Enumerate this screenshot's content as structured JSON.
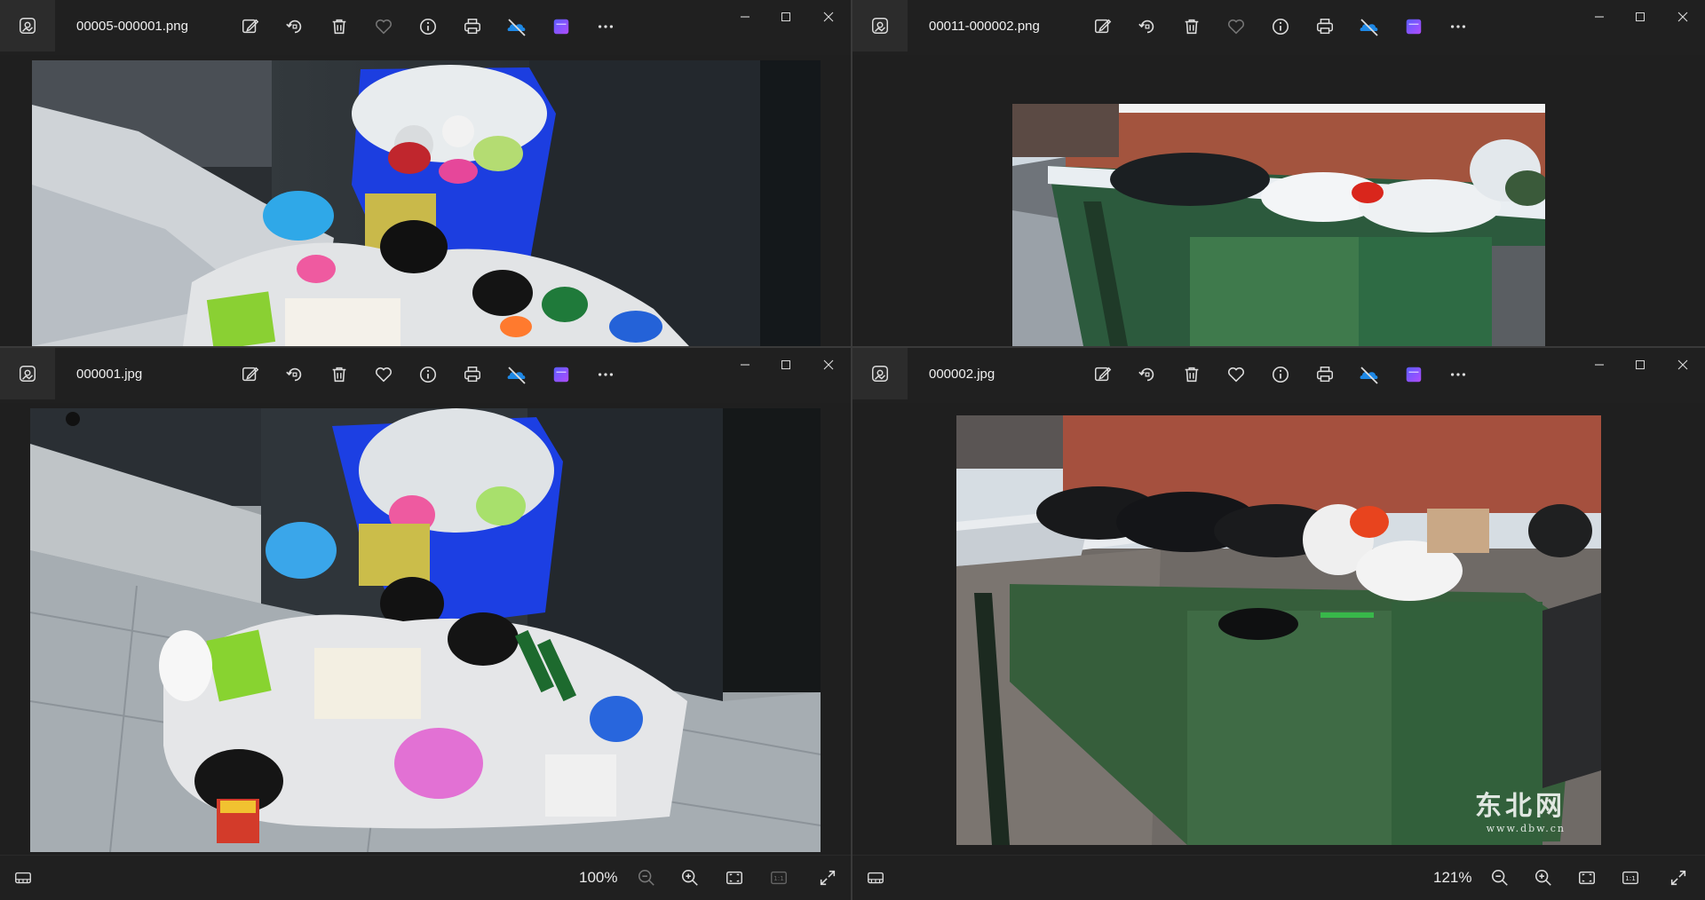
{
  "windows": {
    "tl": {
      "filename": "00005-000001.png"
    },
    "tr": {
      "filename": "00011-000002.png"
    },
    "bl": {
      "filename": "000001.jpg",
      "zoom": "100%"
    },
    "br": {
      "filename": "000002.jpg",
      "zoom": "121%"
    }
  },
  "toolbar_icons": [
    "edit-image-icon",
    "rotate-icon",
    "delete-icon",
    "favorite-icon",
    "info-icon",
    "print-icon",
    "onedrive-icon",
    "clipchamp-icon",
    "more-icon"
  ],
  "window_controls": [
    "minimize-icon",
    "maximize-icon",
    "close-icon"
  ],
  "watermark": {
    "main": "东北网",
    "sub": "www.dbw.cn"
  },
  "colors": {
    "accent_blue": "#1e88e5",
    "clipchamp": "#7b4dff",
    "bg": "#1f1f1f"
  }
}
